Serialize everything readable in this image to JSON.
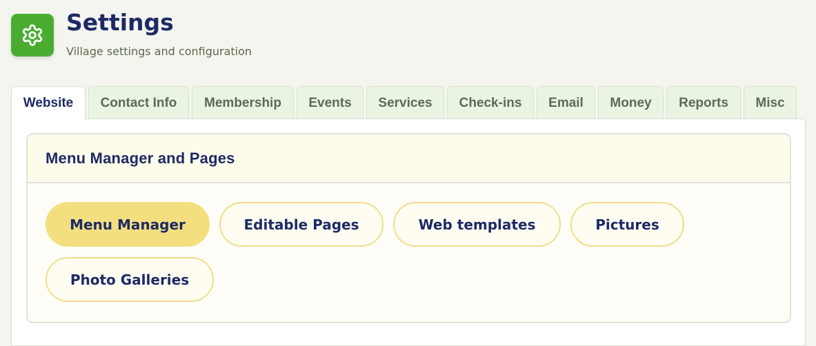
{
  "header": {
    "icon": "gear-icon",
    "accent": "#4aad32",
    "title": "Settings",
    "subtitle": "Village settings and configuration"
  },
  "tabs": [
    {
      "label": "Website",
      "active": true
    },
    {
      "label": "Contact Info",
      "active": false
    },
    {
      "label": "Membership",
      "active": false
    },
    {
      "label": "Events",
      "active": false
    },
    {
      "label": "Services",
      "active": false
    },
    {
      "label": "Check-ins",
      "active": false
    },
    {
      "label": "Email",
      "active": false
    },
    {
      "label": "Money",
      "active": false
    },
    {
      "label": "Reports",
      "active": false
    },
    {
      "label": "Misc",
      "active": false
    }
  ],
  "card": {
    "title": "Menu Manager and Pages",
    "buttons": [
      {
        "label": "Menu Manager",
        "active": true
      },
      {
        "label": "Editable Pages",
        "active": false
      },
      {
        "label": "Web templates",
        "active": false
      },
      {
        "label": "Pictures",
        "active": false
      },
      {
        "label": "Photo Galleries",
        "active": false
      }
    ]
  },
  "colors": {
    "title": "#1d2a64",
    "active_pill": "#f4df80",
    "pill_border": "#f2dd8a",
    "tab_background": "#eaf4e2"
  }
}
